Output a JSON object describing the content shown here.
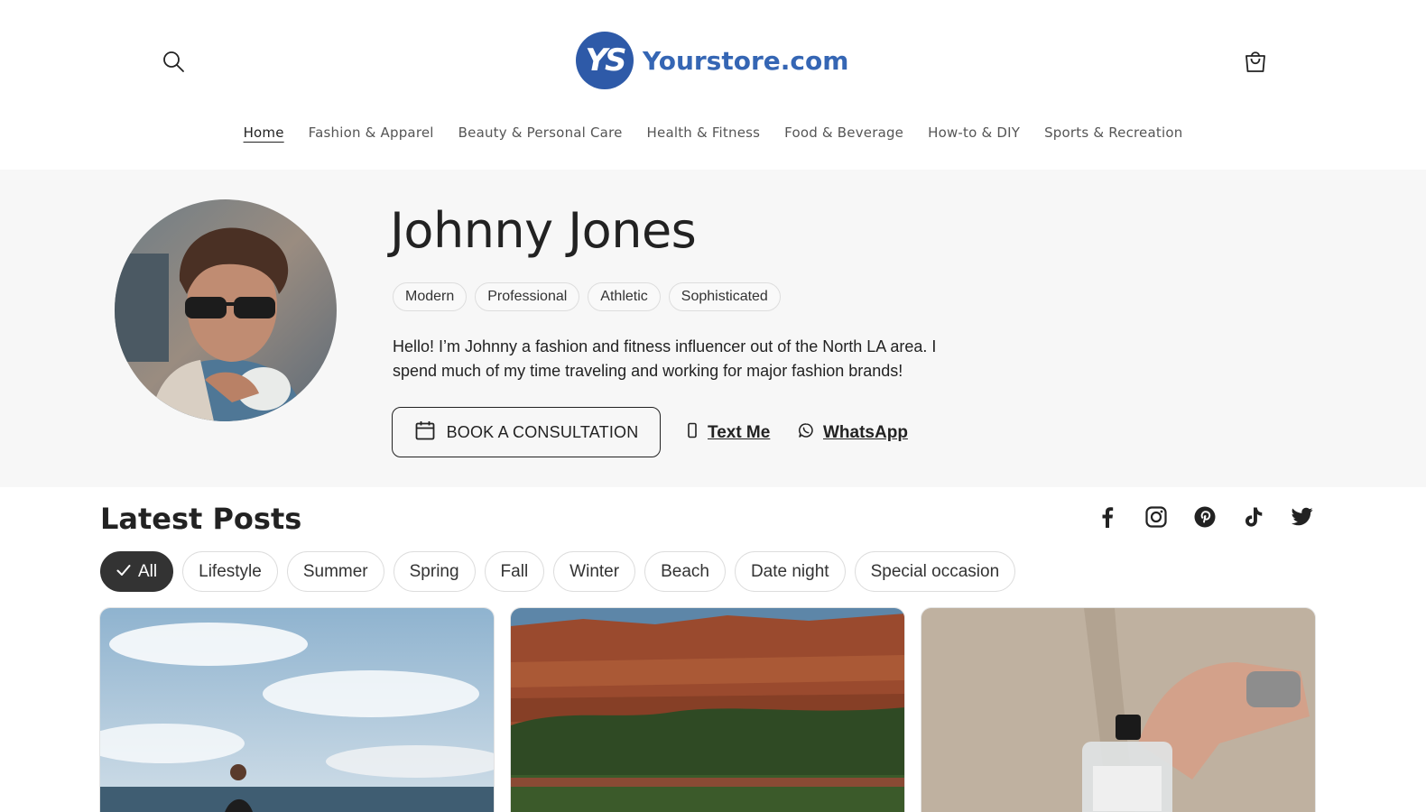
{
  "header": {
    "logo_mark": "YS",
    "logo_text": "Yourstore.com",
    "nav": [
      {
        "label": "Home"
      },
      {
        "label": "Fashion & Apparel"
      },
      {
        "label": "Beauty & Personal Care"
      },
      {
        "label": "Health & Fitness"
      },
      {
        "label": "Food & Beverage"
      },
      {
        "label": "How-to & DIY"
      },
      {
        "label": "Sports & Recreation"
      }
    ]
  },
  "profile": {
    "name": "Johnny Jones",
    "tags": [
      "Modern",
      "Professional",
      "Athletic",
      "Sophisticated"
    ],
    "bio": "Hello! I’m Johnny a fashion and fitness influencer out of the North LA area. I spend much of my time traveling and working for major fashion brands!",
    "book_label": "BOOK A CONSULTATION",
    "text_label": "Text Me",
    "whatsapp_label": "WhatsApp"
  },
  "posts": {
    "title": "Latest Posts",
    "filters": [
      "All",
      "Lifestyle",
      "Summer",
      "Spring",
      "Fall",
      "Winter",
      "Beach",
      "Date night",
      "Special occasion"
    ],
    "active_filter": "All"
  },
  "colors": {
    "brand": "#3566b4",
    "hero_bg": "#f7f7f7",
    "chip_active": "#333333"
  },
  "icons": {
    "search": "search-icon",
    "cart": "cart-icon",
    "calendar": "calendar-icon",
    "phone": "phone-icon",
    "whatsapp": "whatsapp-icon",
    "socials": [
      "facebook-icon",
      "instagram-icon",
      "pinterest-icon",
      "tiktok-icon",
      "twitter-icon"
    ]
  }
}
